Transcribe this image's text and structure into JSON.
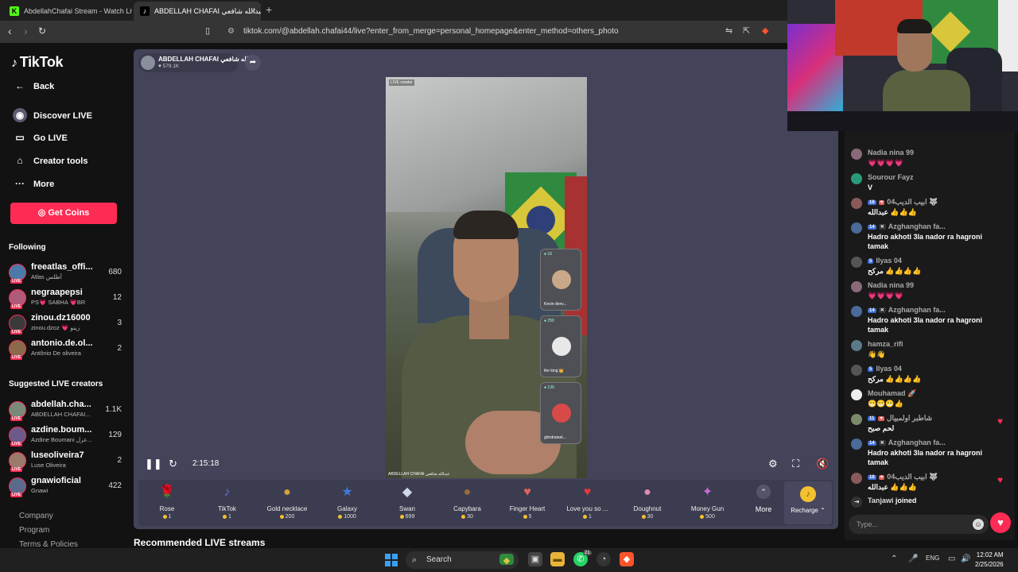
{
  "browser": {
    "tabs": [
      {
        "title": "AbdellahChafai Stream - Watch Live :"
      },
      {
        "title": "ABDELLAH CHAFAI عبدالله شافعي"
      }
    ],
    "url": "tiktok.com/@abdellah.chafai44/live?enter_from_merge=personal_homepage&enter_method=others_photo"
  },
  "sidebar": {
    "logo": "TikTok",
    "back": "Back",
    "nav": [
      {
        "label": "Discover LIVE",
        "icon": "discover-live-icon"
      },
      {
        "label": "Go LIVE",
        "icon": "video-camera-icon"
      },
      {
        "label": "Creator tools",
        "icon": "home-icon"
      },
      {
        "label": "More",
        "icon": "ellipsis-icon"
      }
    ],
    "get_coins": "Get Coins",
    "following_title": "Following",
    "following": [
      {
        "user": "freeatlas_offi...",
        "name": "Atlas أطلس",
        "count": "680"
      },
      {
        "user": "negraapepsi",
        "name": "PS💗 SABHA 💗BR",
        "count": "12"
      },
      {
        "user": "zinou.dz16000",
        "name": "zinou.dzoz 💗 زينو",
        "count": "3"
      },
      {
        "user": "antonio.de.ol...",
        "name": "Antônio De oliveira",
        "count": "2"
      }
    ],
    "suggested_title": "Suggested LIVE creators",
    "suggested": [
      {
        "user": "abdellah.cha...",
        "name": "ABDELLAH CHAFAI...",
        "count": "1.1K"
      },
      {
        "user": "azdine.boum...",
        "name": "Azdine Boumani عزل...",
        "count": "129"
      },
      {
        "user": "luseoliveira7",
        "name": "Luse Oliveira",
        "count": "2"
      },
      {
        "user": "gnawioficial",
        "name": "Gnawi",
        "count": "422"
      }
    ],
    "footer": [
      "Company",
      "Program",
      "Terms & Policies"
    ],
    "live_badge": "LIVE"
  },
  "player": {
    "host_name": "ABDELLAH CHAFAI عبدالله شافعي",
    "host_likes": "♥ 579.1K",
    "video_tag": "LIVE creator",
    "video_footer": "ABDELLAH CHAFAI عبدالله شافعي",
    "guests": [
      {
        "name": "Kevin denv...",
        "count": "● 16"
      },
      {
        "name": "the king 👑",
        "count": "● 250"
      },
      {
        "name": "gõndratset...",
        "count": "● 139"
      }
    ],
    "timecode": "2:15:18",
    "recommended": "Recommended LIVE streams"
  },
  "gifts": [
    {
      "name": "Rose",
      "price": "1",
      "icon": "🌹",
      "color": "#c0392b"
    },
    {
      "name": "TikTok",
      "price": "1",
      "icon": "♪",
      "color": "#6b6bd6"
    },
    {
      "name": "Gold necklace",
      "price": "200",
      "icon": "●",
      "color": "#d4a23a"
    },
    {
      "name": "Galaxy",
      "price": "1000",
      "icon": "★",
      "color": "#3b7bd8"
    },
    {
      "name": "Swan",
      "price": "699",
      "icon": "◆",
      "color": "#cfd8e8"
    },
    {
      "name": "Capybara",
      "price": "30",
      "icon": "●",
      "color": "#9a6a3a"
    },
    {
      "name": "Finger Heart",
      "price": "5",
      "icon": "♥",
      "color": "#e2625a"
    },
    {
      "name": "Love you so ...",
      "price": "1",
      "icon": "♥",
      "color": "#e23a3a"
    },
    {
      "name": "Doughnut",
      "price": "30",
      "icon": "●",
      "color": "#e08bb0"
    },
    {
      "name": "Money Gun",
      "price": "500",
      "icon": "✦",
      "color": "#c86bd6"
    }
  ],
  "gift_more": "More",
  "recharge": "Recharge ⌃",
  "chat": {
    "messages": [
      {
        "user": "Nadia nina 99",
        "text": "💗💗💗💗",
        "badges": []
      },
      {
        "user": "Sourour Fayz",
        "text": "V",
        "badges": []
      },
      {
        "user": "ابيب الديب04 🐺",
        "text": "عبدالله 👍👍👍",
        "badges": [
          "18",
          "♥"
        ]
      },
      {
        "user": "Azghanghan fa...",
        "text": "Hadro akhoti 3la nador ra hagroni tamak",
        "badges": [
          "14",
          "✕"
        ]
      },
      {
        "user": "Ilyas 04",
        "text": "مركح 👍👍👍👍",
        "badges": [
          "5"
        ]
      },
      {
        "user": "Nadia nina 99",
        "text": "💗💗💗💗",
        "badges": []
      },
      {
        "user": "Azghanghan fa...",
        "text": "Hadro akhoti 3la nador ra hagroni tamak",
        "badges": [
          "14",
          "✕"
        ]
      },
      {
        "user": "hamza_rifi",
        "text": "👋👋",
        "badges": []
      },
      {
        "user": "Ilyas 04",
        "text": "مركح 👍👍👍👍",
        "badges": [
          "5"
        ]
      },
      {
        "user": "Mouhamad 🚀",
        "text": "😁😁😁👍",
        "badges": []
      },
      {
        "user": "شاطبر اولمبيال",
        "text": "لحم صبح",
        "badges": [
          "11",
          "♥"
        ]
      },
      {
        "user": "Azghanghan fa...",
        "text": "Hadro akhoti 3la nador ra hagroni tamak",
        "badges": [
          "14",
          "✕"
        ]
      },
      {
        "user": "ابيب الديب04 🐺",
        "text": "عبدالله 👍👍👍",
        "badges": [
          "18",
          "♥"
        ]
      }
    ],
    "joined_user": "Tanjawi",
    "joined_text": "joined",
    "placeholder": "Type..."
  },
  "taskbar": {
    "search": "Search",
    "lang": "ENG",
    "time": "12:02 AM",
    "date": "2/25/2026",
    "whatsapp_badge": "21"
  },
  "colors": {
    "accent": "#fe2c55",
    "player_bg": "#43435a",
    "sidebar_bg": "#121212"
  }
}
